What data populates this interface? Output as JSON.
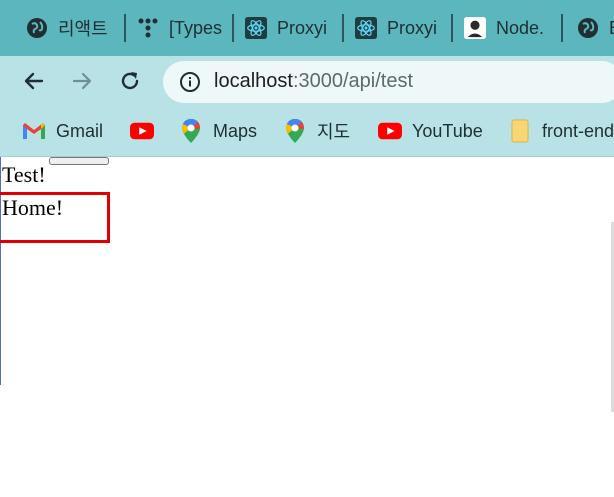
{
  "tabs": [
    {
      "label": "리액트",
      "icon": "globe-icon"
    },
    {
      "label": "[Types",
      "icon": "dots-icon"
    },
    {
      "label": "Proxyi",
      "icon": "react-icon"
    },
    {
      "label": "Proxyi",
      "icon": "react-icon"
    },
    {
      "label": "Node.",
      "icon": "avatar-icon"
    },
    {
      "label": "E",
      "icon": "globe-icon"
    }
  ],
  "toolbar": {
    "url_host": "localhost",
    "url_path": ":3000/api/test"
  },
  "bookmarks": [
    {
      "label": "Gmail",
      "icon": "gmail-icon"
    },
    {
      "label": "",
      "icon": "youtube-icon"
    },
    {
      "label": "Maps",
      "icon": "maps-pin-icon"
    },
    {
      "label": "지도",
      "icon": "maps-pin-icon"
    },
    {
      "label": "YouTube",
      "icon": "youtube-icon"
    },
    {
      "label": "front-end",
      "icon": "folder-icon"
    }
  ],
  "page": {
    "test_text": "Test!",
    "home_text": "Home!"
  },
  "colors": {
    "tabstrip": "#5bb6bd",
    "toolbar": "#b9e2e6",
    "highlight": "#e00000"
  }
}
